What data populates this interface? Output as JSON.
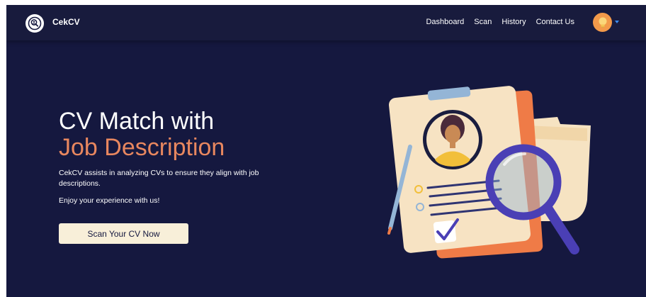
{
  "navbar": {
    "brand": "CekCV",
    "links": [
      "Dashboard",
      "Scan",
      "History",
      "Contact Us"
    ]
  },
  "hero": {
    "title_line1": "CV Match with",
    "title_line2": "Job Description",
    "description": "CekCV assists in analyzing CVs to ensure they align with job descriptions.",
    "enjoy": "Enjoy your experience with us!",
    "cta_label": "Scan Your CV Now"
  },
  "colors": {
    "background": "#15183f",
    "navbar": "#181b3d",
    "accent": "#e8875f",
    "button_bg": "#f8efd9"
  },
  "icons": {
    "logo": "magnifier-person-icon",
    "avatar": "lightbulb-icon",
    "dropdown": "caret-down-icon"
  }
}
